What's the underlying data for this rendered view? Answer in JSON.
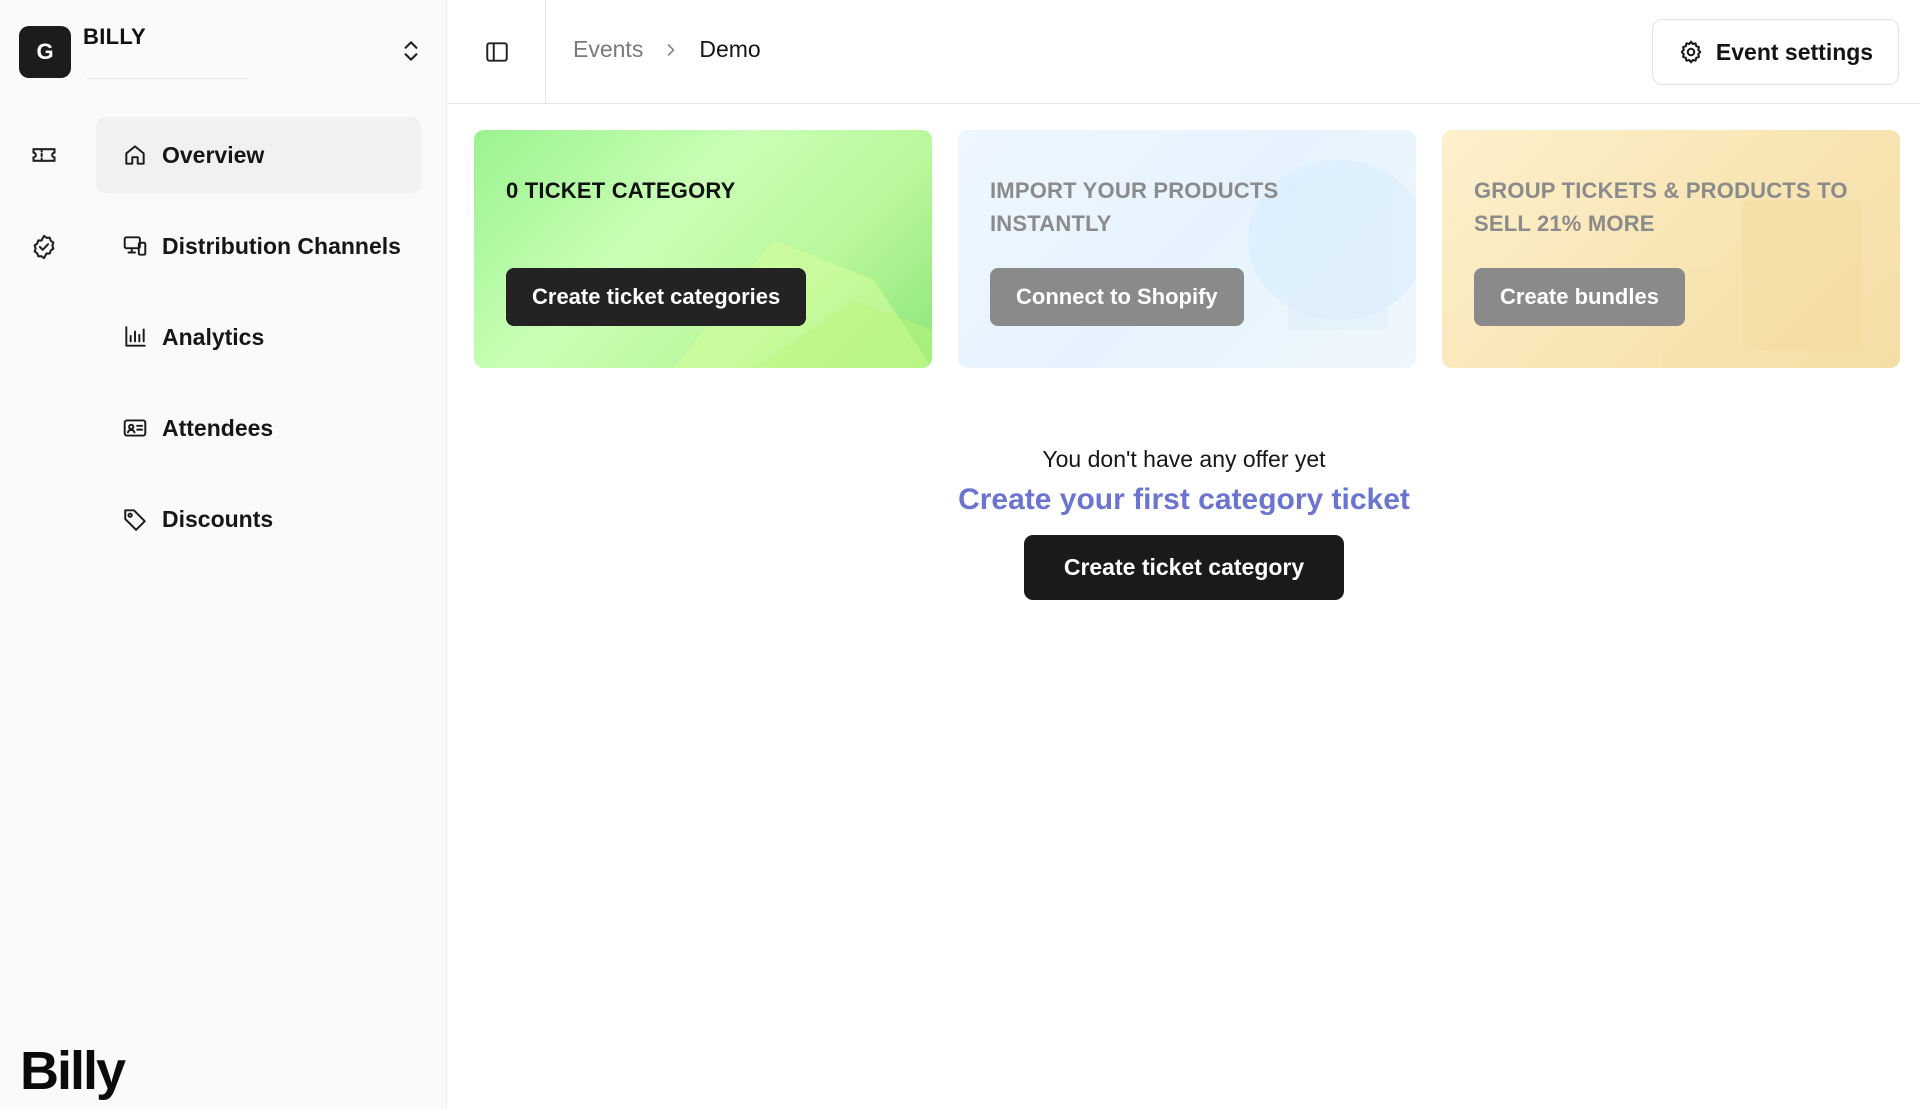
{
  "org": {
    "avatar_letter": "G",
    "name": "BILLY"
  },
  "sidebar": {
    "items": [
      {
        "label": "Overview",
        "icon": "home-icon",
        "active": true
      },
      {
        "label": "Distribution Channels",
        "icon": "devices-icon",
        "active": false
      },
      {
        "label": "Analytics",
        "icon": "bar-chart-icon",
        "active": false
      },
      {
        "label": "Attendees",
        "icon": "id-card-icon",
        "active": false
      },
      {
        "label": "Discounts",
        "icon": "tag-icon",
        "active": false
      }
    ],
    "rail_icons": [
      "ticket-icon",
      "check-badge-icon"
    ],
    "brand": "Billy"
  },
  "topbar": {
    "breadcrumb": {
      "parent": "Events",
      "current": "Demo"
    },
    "settings_label": "Event settings"
  },
  "cards": [
    {
      "title": "0 TICKET CATEGORY",
      "button": "Create ticket categories",
      "accent": "#9bf28f"
    },
    {
      "title": "IMPORT YOUR PRODUCTS INSTANTLY",
      "button": "Connect to Shopify",
      "accent": "#e6f3ff"
    },
    {
      "title": "GROUP TICKETS & PRODUCTS TO SELL 21% MORE",
      "button": "Create bundles",
      "accent": "#f9e6b6"
    }
  ],
  "empty_state": {
    "message": "You don't have any offer yet",
    "cta": "Create your first category ticket",
    "button": "Create ticket category"
  },
  "colors": {
    "primary_dark": "#1a1a1a",
    "cta_link": "#6b74cf",
    "sidebar_bg": "#fafafa"
  }
}
